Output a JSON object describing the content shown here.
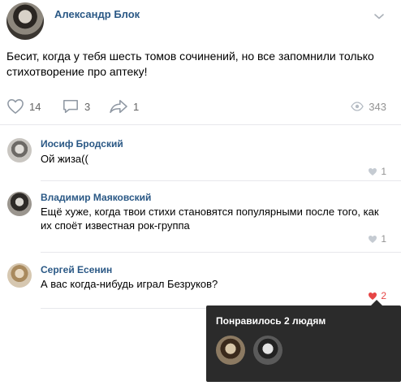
{
  "post": {
    "author": "Александр Блок",
    "text": "Бесит, когда у тебя шесть томов сочинений, но все запомнили только стихотворение про аптеку!",
    "likes": "14",
    "comments": "3",
    "shares": "1",
    "views": "343"
  },
  "comments": [
    {
      "author": "Иосиф Бродский",
      "text": "Ой жиза((",
      "likes": "1"
    },
    {
      "author": "Владимир Маяковский",
      "text": "Ещё хуже, когда твои стихи становятся популярными после того, как их спoёт известная рок-группа",
      "likes": "1"
    },
    {
      "author": "Сергей Есенин",
      "text": "А вас когда-нибудь играл Безруков?",
      "likes": "2"
    }
  ],
  "likes_tooltip": {
    "title": "Понравилось 2 людям"
  },
  "colors": {
    "name_link": "#2a5885",
    "icon_gray": "#8f98a3",
    "liked_red": "#e64646",
    "tooltip_bg": "#2b2b2b"
  },
  "icons": [
    "chevron-down-icon",
    "heart-icon",
    "comment-icon",
    "share-icon",
    "eye-icon"
  ]
}
